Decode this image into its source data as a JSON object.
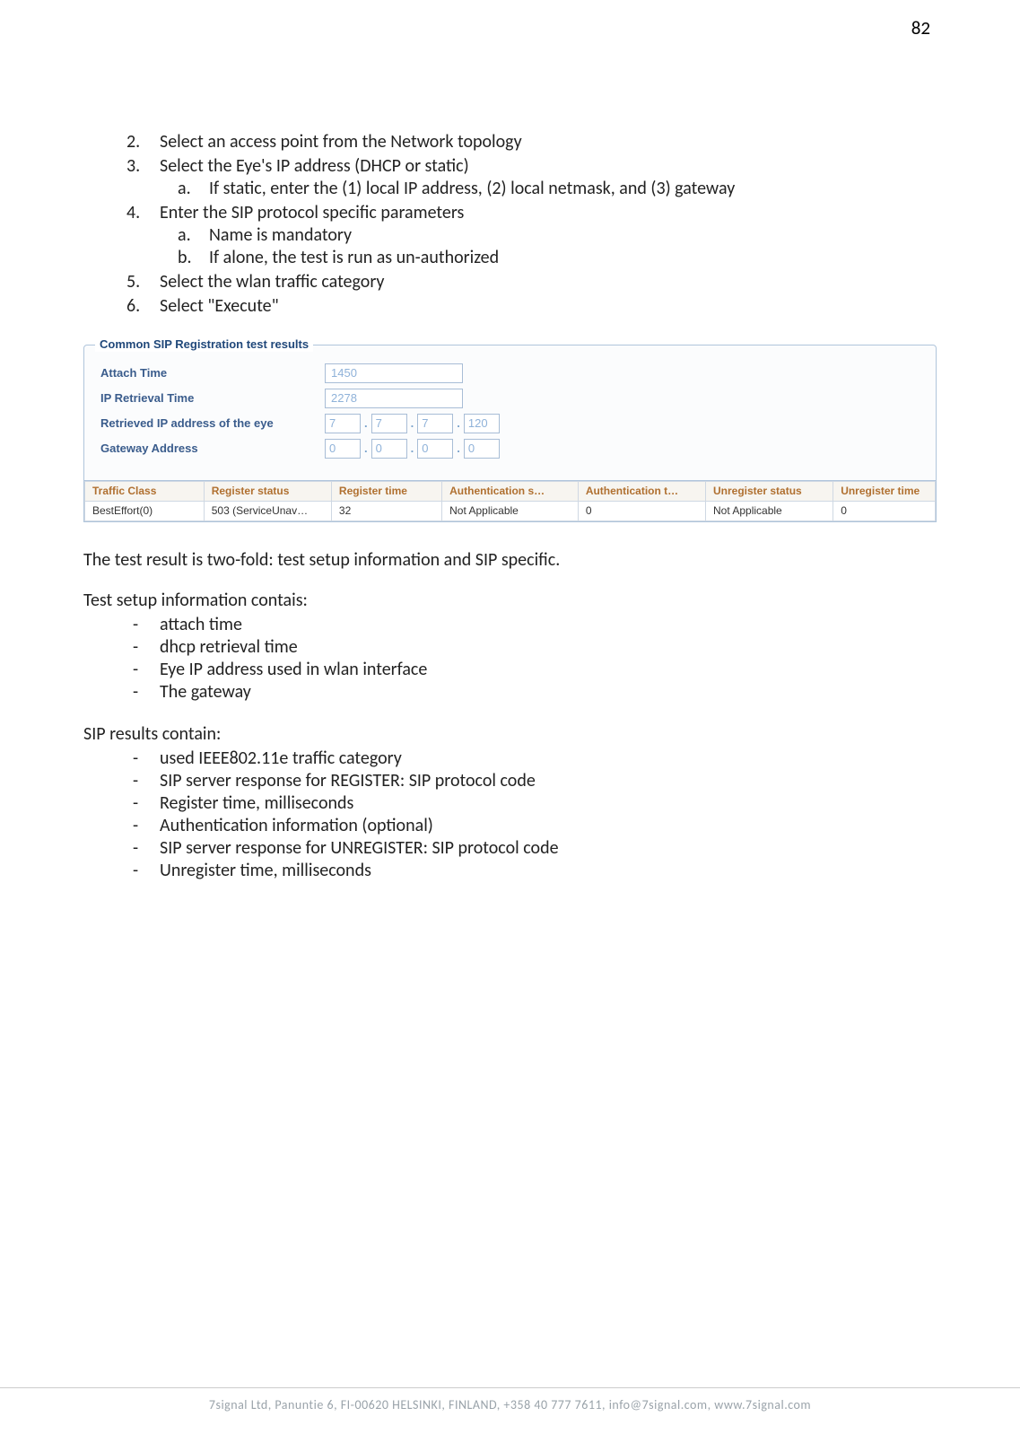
{
  "page_number": "82",
  "steps": {
    "s2": "Select an access point from the Network topology",
    "s3": "Select the Eye's IP address (DHCP or static)",
    "s3a": "If static, enter the (1) local IP address, (2) local netmask, and (3) gateway",
    "s4": "Enter the SIP protocol specific parameters",
    "s4a": "Name is mandatory",
    "s4b": "If alone, the test is run as un-authorized",
    "s5": "Select the wlan traffic category",
    "s6": "Select \"Execute\""
  },
  "panel": {
    "legend": "Common SIP Registration test results",
    "attach_label": "Attach Time",
    "attach_value": "1450",
    "ipret_label": "IP Retrieval Time",
    "ipret_value": "2278",
    "ipaddr_label": "Retrieved IP address of the eye",
    "ip": {
      "a": "7",
      "b": "7",
      "c": "7",
      "d": "120"
    },
    "gw_label": "Gateway Address",
    "gw": {
      "a": "0",
      "b": "0",
      "c": "0",
      "d": "0"
    }
  },
  "table": {
    "headers": {
      "c1": "Traffic Class",
      "c2": "Register status",
      "c3": "Register time",
      "c4": "Authentication s…",
      "c5": "Authentication t…",
      "c6": "Unregister status",
      "c7": "Unregister time"
    },
    "row": {
      "c1": "BestEffort(0)",
      "c2": "503 (ServiceUnav…",
      "c3": "32",
      "c4": "Not Applicable",
      "c5": "0",
      "c6": "Not Applicable",
      "c7": "0"
    }
  },
  "text": {
    "para1": "The test result is two-fold: test setup information and SIP specific.",
    "setup_header": "Test setup information contais:",
    "setup": {
      "i1": "attach time",
      "i2": "dhcp retrieval time",
      "i3": "Eye IP address used in wlan interface",
      "i4": "The gateway"
    },
    "sip_header": "SIP results contain:",
    "sip": {
      "i1": "used IEEE802.11e traffic category",
      "i2": "SIP server response for REGISTER: SIP protocol code",
      "i3": "Register time, milliseconds",
      "i4": "Authentication information (optional)",
      "i5": "SIP server response for UNREGISTER: SIP protocol code",
      "i6": "Unregister time, milliseconds"
    }
  },
  "footer": "7signal Ltd, Panuntie 6, FI-00620 HELSINKI, FINLAND, +358 40 777 7611, info@7signal.com, www.7signal.com"
}
